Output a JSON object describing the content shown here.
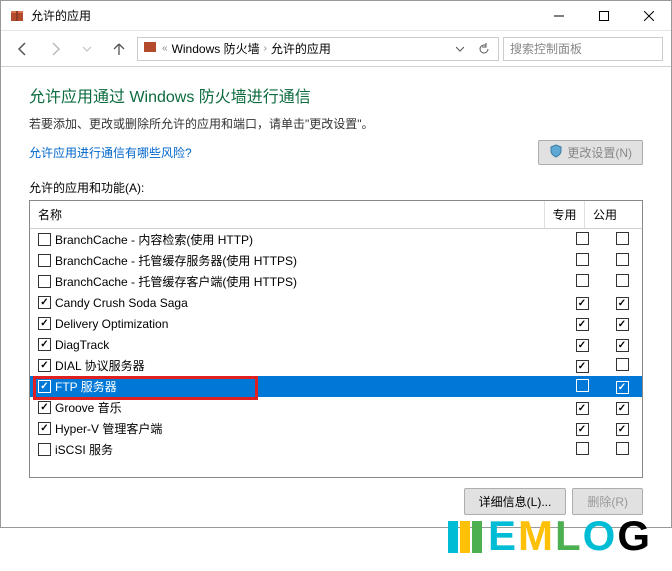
{
  "titlebar": {
    "title": "允许的应用"
  },
  "breadcrumb": {
    "seg1": "Windows 防火墙",
    "seg2": "允许的应用"
  },
  "search": {
    "placeholder": "搜索控制面板"
  },
  "heading": "允许应用通过 Windows 防火墙进行通信",
  "subtext": "若要添加、更改或删除所允许的应用和端口，请单击\"更改设置\"。",
  "risk_link": "允许应用进行通信有哪些风险?",
  "change_btn": "更改设置(N)",
  "list_label": "允许的应用和功能(A):",
  "columns": {
    "name": "名称",
    "private": "专用",
    "public": "公用"
  },
  "rows": [
    {
      "enabled": false,
      "name": "BranchCache - 内容检索(使用 HTTP)",
      "priv": false,
      "pub": false,
      "selected": false
    },
    {
      "enabled": false,
      "name": "BranchCache - 托管缓存服务器(使用 HTTPS)",
      "priv": false,
      "pub": false,
      "selected": false
    },
    {
      "enabled": false,
      "name": "BranchCache - 托管缓存客户端(使用 HTTPS)",
      "priv": false,
      "pub": false,
      "selected": false
    },
    {
      "enabled": true,
      "name": "Candy Crush Soda Saga",
      "priv": true,
      "pub": true,
      "selected": false
    },
    {
      "enabled": true,
      "name": "Delivery Optimization",
      "priv": true,
      "pub": true,
      "selected": false
    },
    {
      "enabled": true,
      "name": "DiagTrack",
      "priv": true,
      "pub": true,
      "selected": false
    },
    {
      "enabled": true,
      "name": "DIAL 协议服务器",
      "priv": true,
      "pub": false,
      "selected": false
    },
    {
      "enabled": true,
      "name": "FTP 服务器",
      "priv": false,
      "pub": true,
      "selected": true
    },
    {
      "enabled": true,
      "name": "Groove 音乐",
      "priv": true,
      "pub": true,
      "selected": false
    },
    {
      "enabled": true,
      "name": "Hyper-V 管理客户端",
      "priv": true,
      "pub": true,
      "selected": false
    },
    {
      "enabled": false,
      "name": "iSCSI 服务",
      "priv": false,
      "pub": false,
      "selected": false
    }
  ],
  "details_btn": "详细信息(L)...",
  "remove_btn": "删除(R)",
  "watermark": "EMLOG"
}
